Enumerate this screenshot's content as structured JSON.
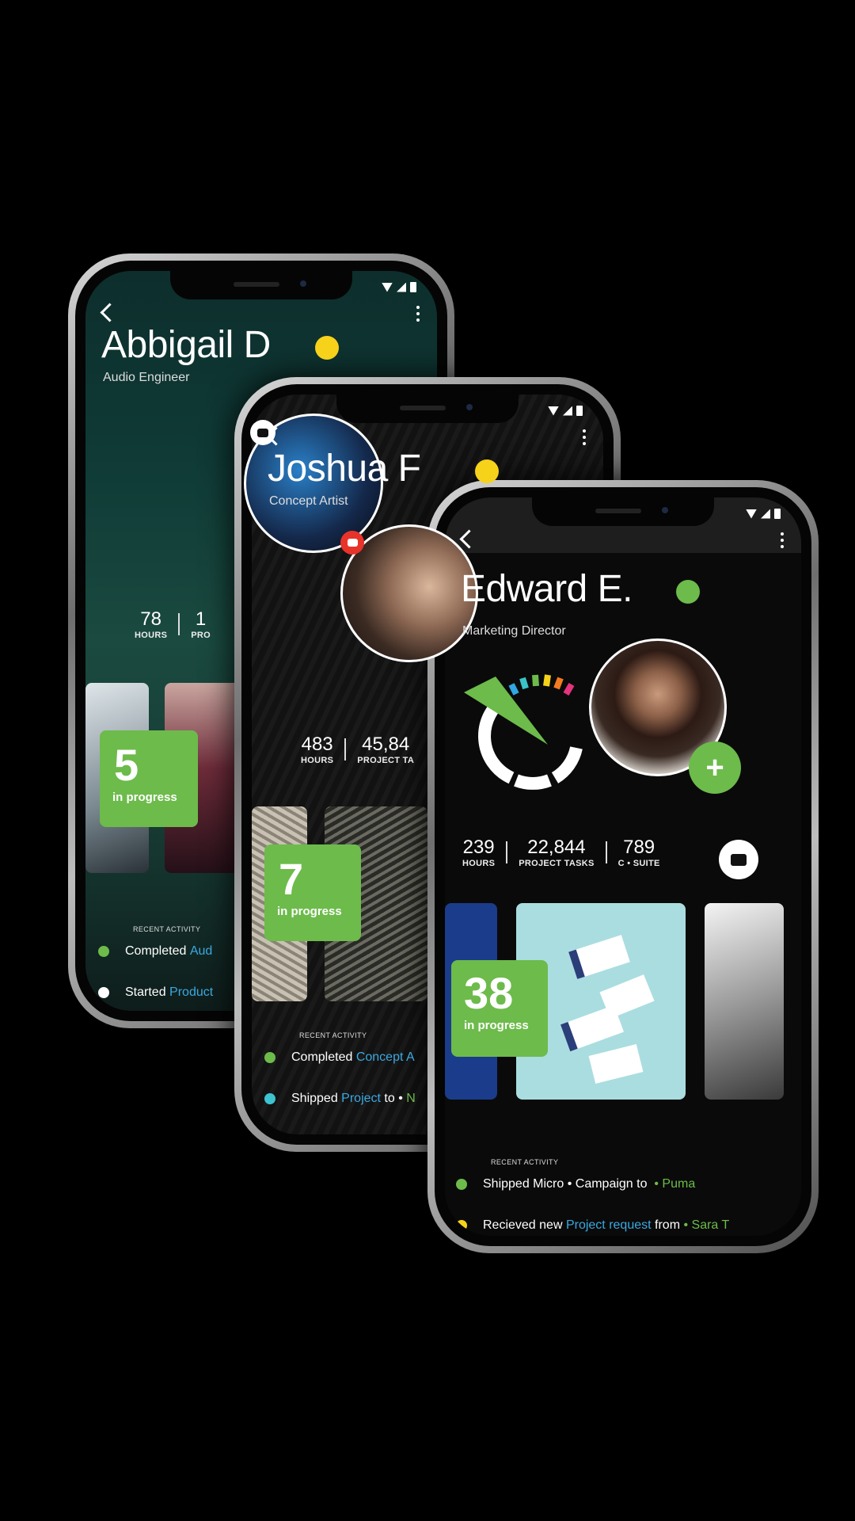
{
  "phones": [
    {
      "name": "Abbigail D",
      "role": "Audio Engineer",
      "status_color": "#f6d21b",
      "stats": [
        {
          "value": "78",
          "label": "HOURS"
        },
        {
          "value": "1",
          "label": "PRO"
        }
      ],
      "progress": {
        "count": "5",
        "label": "in progress"
      },
      "activity_header": "RECENT ACTIVITY",
      "activity": [
        {
          "action": "Completed",
          "target": "Aud"
        },
        {
          "action": "Started",
          "target": "Product"
        }
      ]
    },
    {
      "name": "Joshua F",
      "role": "Concept Artist",
      "status_color": "#f6d21b",
      "stats": [
        {
          "value": "483",
          "label": "HOURS"
        },
        {
          "value": "45,84",
          "label": "PROJECT TA"
        }
      ],
      "progress": {
        "count": "7",
        "label": "in progress"
      },
      "activity_header": "RECENT ACTIVITY",
      "activity": [
        {
          "action": "Completed",
          "target": "Concept A"
        },
        {
          "action": "Shipped",
          "target": "Project",
          "suffix": "to •",
          "extra": "N"
        }
      ]
    },
    {
      "name": "Edward E.",
      "role": "Marketing Director",
      "status_color": "#6dbb4b",
      "stats": [
        {
          "value": "239",
          "label": "HOURS"
        },
        {
          "value": "22,844",
          "label": "PROJECT TASKS"
        },
        {
          "value": "789",
          "label": "C • SUITE"
        }
      ],
      "progress": {
        "count": "38",
        "label": "in progress"
      },
      "add_icon": "+",
      "activity_header": "RECENT ACTIVITY",
      "activity": [
        {
          "action": "Shipped Micro • Campaign to",
          "extra": "• Puma"
        },
        {
          "action": "Recieved new",
          "target": "Project request",
          "suffix": "from",
          "extra": "• Sara T"
        }
      ]
    }
  ],
  "icons": {
    "back": "chevron-left-icon",
    "menu": "kebab-icon",
    "chat": "chat-bubble-icon",
    "add": "plus-icon"
  }
}
